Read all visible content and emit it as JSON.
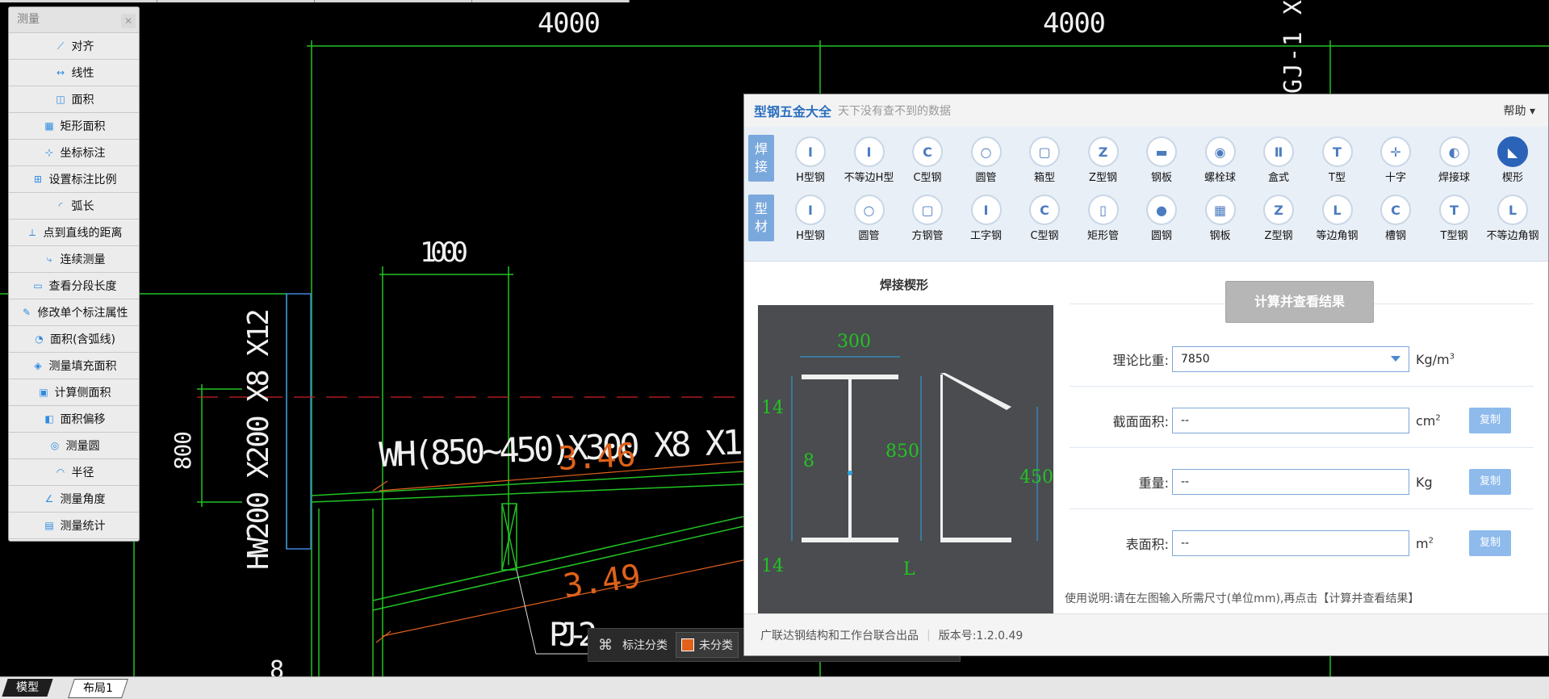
{
  "measure_panel": {
    "title": "测量",
    "items": [
      {
        "label": "对齐",
        "icon": "align-measure-icon"
      },
      {
        "label": "线性",
        "icon": "linear-measure-icon"
      },
      {
        "label": "面积",
        "icon": "area-icon"
      },
      {
        "label": "矩形面积",
        "icon": "rect-area-icon"
      },
      {
        "label": "坐标标注",
        "icon": "coordinate-icon"
      },
      {
        "label": "设置标注比例",
        "icon": "scale-icon"
      },
      {
        "label": "弧长",
        "icon": "arc-length-icon"
      },
      {
        "label": "点到直线的距离",
        "icon": "point-line-distance-icon"
      },
      {
        "label": "连续测量",
        "icon": "continuous-measure-icon"
      },
      {
        "label": "查看分段长度",
        "icon": "segment-length-icon"
      },
      {
        "label": "修改单个标注属性",
        "icon": "edit-annotation-icon"
      },
      {
        "label": "面积(含弧线)",
        "icon": "arc-area-icon"
      },
      {
        "label": "测量填充面积",
        "icon": "fill-area-icon"
      },
      {
        "label": "计算侧面积",
        "icon": "side-area-icon"
      },
      {
        "label": "面积偏移",
        "icon": "area-offset-icon"
      },
      {
        "label": "测量圆",
        "icon": "circle-measure-icon"
      },
      {
        "label": "半径",
        "icon": "radius-icon"
      },
      {
        "label": "测量角度",
        "icon": "angle-icon"
      },
      {
        "label": "测量统计",
        "icon": "statistics-icon"
      }
    ]
  },
  "cad": {
    "dim_4000_a": "4000",
    "dim_4000_b": "4000",
    "dim_1000": "1000",
    "dim_800": "800",
    "col_label": "HW200 X200 X8 X12",
    "beam_label": "WH(850~450)X300 X8 X1",
    "num_a": "3.46",
    "num_b": "3.49",
    "pj_label": "PJ-2",
    "top_right_label": "GJ-1 X",
    "bottom_mark": "8"
  },
  "category_bar": {
    "label": "标注分类",
    "selected": "未分类"
  },
  "tabs": [
    "模型",
    "布局1"
  ],
  "steel_dialog": {
    "app_name": "型钢五金大全",
    "slogan": "天下没有查不到的数据",
    "help": "帮助",
    "row1_label": "焊接",
    "row2_label": "型材",
    "row1": [
      "H型钢",
      "不等边H型",
      "C型钢",
      "圆管",
      "箱型",
      "Z型钢",
      "钢板",
      "螺栓球",
      "盒式",
      "T型",
      "十字",
      "焊接球",
      "楔形"
    ],
    "row2": [
      "H型钢",
      "圆管",
      "方钢管",
      "工字钢",
      "C型钢",
      "矩形管",
      "圆钢",
      "钢板",
      "Z型钢",
      "等边角钢",
      "槽钢",
      "T型钢",
      "不等边角钢"
    ],
    "diagram_title": "焊接楔形",
    "dims": {
      "top": "300",
      "flange_top": "14",
      "web": "8",
      "height": "850",
      "end_height": "450",
      "flange_bottom": "14",
      "length": "L"
    },
    "calc_button": "计算并查看结果",
    "fields": [
      {
        "label": "理论比重:",
        "value": "7850",
        "unit": "Kg/m",
        "sup": "3",
        "dropdown": true,
        "copy": ""
      },
      {
        "label": "截面面积:",
        "value": "--",
        "unit": "cm",
        "sup": "2",
        "dropdown": false,
        "copy": "复制"
      },
      {
        "label": "重量:",
        "value": "--",
        "unit": "Kg",
        "sup": "",
        "dropdown": false,
        "copy": "复制"
      },
      {
        "label": "表面积:",
        "value": "--",
        "unit": "m",
        "sup": "2",
        "dropdown": false,
        "copy": "复制"
      }
    ],
    "note": "使用说明:请在左图输入所需尺寸(单位mm),再点击【计算并查看结果】",
    "footer_company": "广联达钢结构和工作台联合出品",
    "footer_version": "版本号:1.2.0.49"
  },
  "colors": {
    "cad_green": "#22c322",
    "cad_orange": "#e0611a",
    "cad_red": "#d02020",
    "accent_blue": "#2b63b9"
  }
}
